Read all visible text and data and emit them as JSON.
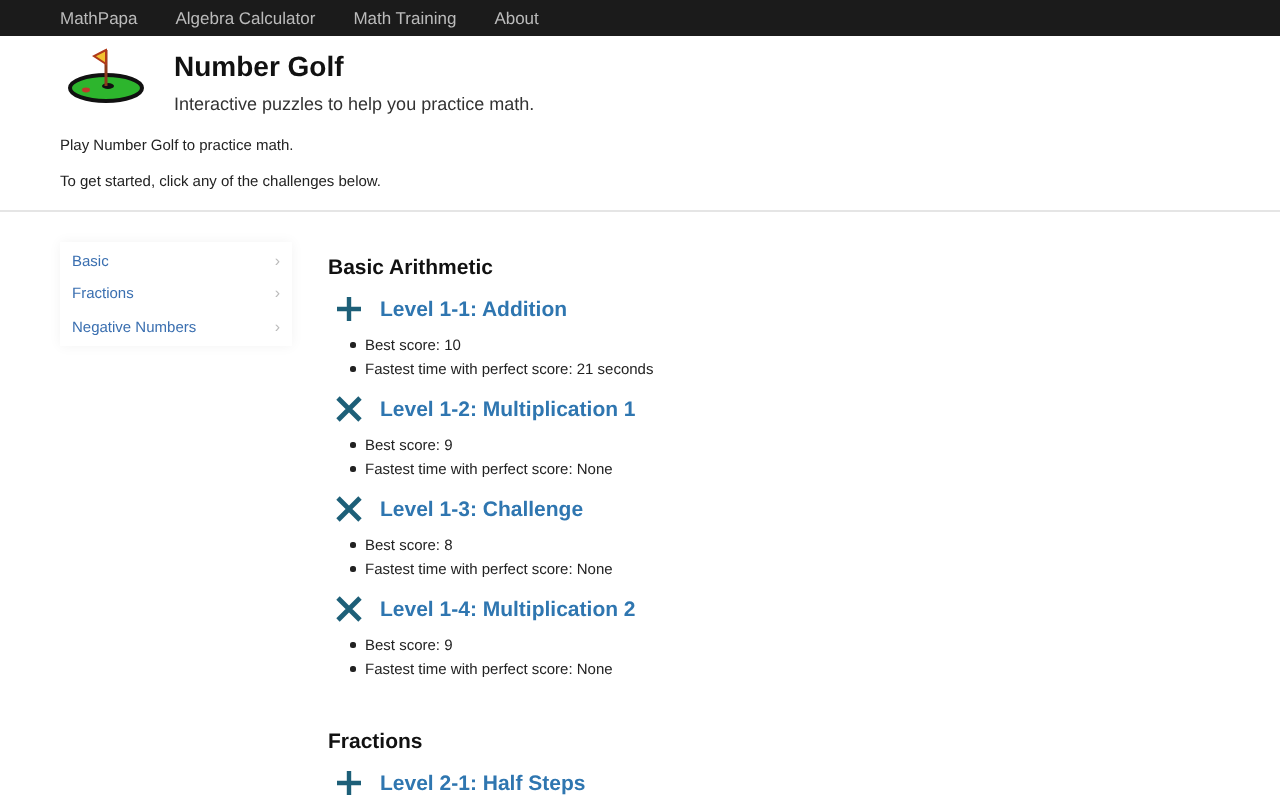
{
  "navbar": {
    "items": [
      {
        "label": "MathPapa"
      },
      {
        "label": "Algebra Calculator"
      },
      {
        "label": "Math Training"
      },
      {
        "label": "About"
      }
    ]
  },
  "header": {
    "title": "Number Golf",
    "subtitle": "Interactive puzzles to help you practice math."
  },
  "intro": [
    "Play Number Golf to practice math.",
    "To get started, click any of the challenges below."
  ],
  "sidebar": {
    "items": [
      {
        "label": "Basic",
        "arrow": "›"
      },
      {
        "label": "Fractions",
        "arrow": "›"
      },
      {
        "label": "Negative Numbers",
        "arrow": "›"
      }
    ]
  },
  "sections": [
    {
      "heading": "Basic Arithmetic",
      "levels": [
        {
          "kind": "plus",
          "title": "Level 1-1: Addition",
          "stats": [
            "Best score: 10",
            "Fastest time with perfect score: 21 seconds"
          ]
        },
        {
          "kind": "times",
          "title": "Level 1-2: Multiplication 1",
          "stats": [
            "Best score: 9",
            "Fastest time with perfect score: None"
          ]
        },
        {
          "kind": "times",
          "title": "Level 1-3: Challenge",
          "stats": [
            "Best score: 8",
            "Fastest time with perfect score: None"
          ]
        },
        {
          "kind": "times",
          "title": "Level 1-4: Multiplication 2",
          "stats": [
            "Best score: 9",
            "Fastest time with perfect score: None"
          ]
        }
      ]
    },
    {
      "heading": "Fractions",
      "levels": [
        {
          "kind": "plus",
          "title": "Level 2-1: Half Steps"
        }
      ]
    }
  ]
}
